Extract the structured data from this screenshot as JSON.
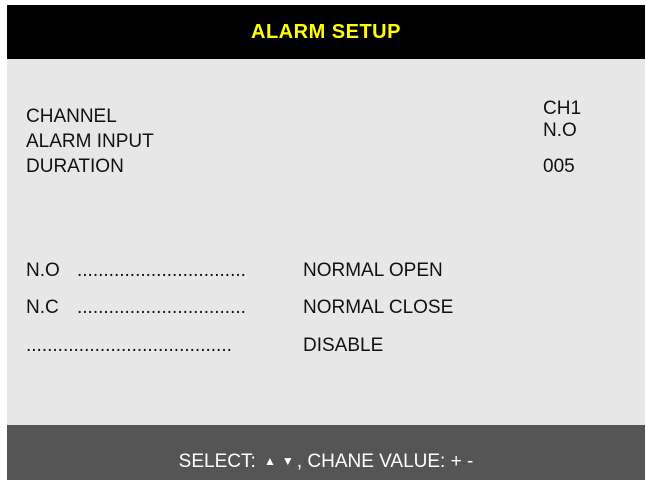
{
  "title": "ALARM SETUP",
  "settings": [
    {
      "label": "CHANNEL",
      "value": "CH1"
    },
    {
      "label": "ALARM INPUT",
      "value": "N.O"
    },
    {
      "label": "DURATION",
      "value": "005"
    }
  ],
  "legend": [
    {
      "code": "N.O",
      "dots": "................................",
      "desc": "NORMAL OPEN"
    },
    {
      "code": "N.C",
      "dots": "................................",
      "desc": "NORMAL CLOSE"
    },
    {
      "code": "",
      "dots": ".......................................",
      "desc": "DISABLE"
    }
  ],
  "status": {
    "select_label": "SELECT:",
    "up_arrow": "▲",
    "down_arrow": "▼",
    "change_label": ", CHANE VALUE: + -"
  },
  "colors": {
    "title_bg": "#000000",
    "title_text": "#ffff00",
    "panel_bg": "#e7e7e7",
    "status_bg": "#555555",
    "status_text": "#ffffff"
  }
}
